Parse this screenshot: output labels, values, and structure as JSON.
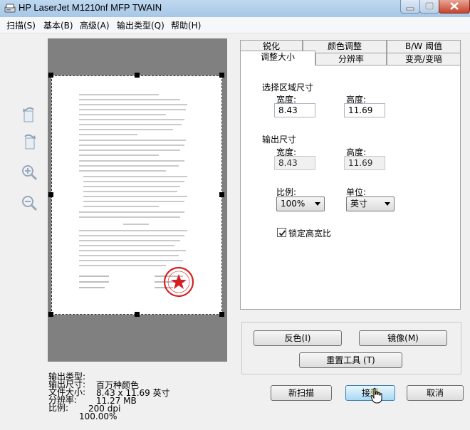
{
  "window": {
    "title": "HP LaserJet M1210nf MFP TWAIN",
    "icons": [
      "scanner-app-icon",
      "minimize-icon",
      "maximize-icon",
      "close-icon"
    ]
  },
  "menu": [
    {
      "label": "扫描(S)"
    },
    {
      "label": "基本(B)"
    },
    {
      "label": "高级(A)"
    },
    {
      "label": "输出类型(Q)"
    },
    {
      "label": "帮助(H)"
    }
  ],
  "tools": [
    "rotate-left-icon",
    "rotate-right-icon",
    "zoom-in-icon",
    "zoom-out-icon"
  ],
  "info": {
    "output_type_label": "输出类型:",
    "output_type_value": "百万种颜色",
    "output_size_label": "输出尺寸:",
    "output_size_value": "8.43 x 11.69 英寸",
    "file_size_label": "文件大小:",
    "file_size_value": "11.27 MB",
    "resolution_label": "分辨率:",
    "resolution_value": "200 dpi",
    "scale_label": "比例:",
    "scale_value": "100.00%"
  },
  "tabs": {
    "row1": [
      "锐化",
      "颜色调整",
      "B/W 阈值"
    ],
    "row2": [
      "调整大小",
      "分辨率",
      "变亮/变暗"
    ],
    "active": "调整大小"
  },
  "resize": {
    "select_area_heading": "选择区域尺寸",
    "width_label": "宽度:",
    "height_label": "高度:",
    "select_width": "8.43",
    "select_height": "11.69",
    "output_heading": "输出尺寸",
    "output_width_label": "宽度:",
    "output_height_label": "高度:",
    "output_width": "8.43",
    "output_height": "11.69",
    "ratio_label": "比例:",
    "ratio_value": "100%",
    "unit_label": "单位:",
    "unit_value": "英寸",
    "lock_label": "锁定高宽比",
    "lock_checked": true
  },
  "buttons": {
    "invert": "反色(I)",
    "mirror": "镜像(M)",
    "reset": "重置工具 (T)",
    "new_scan": "新扫描",
    "accept": "接受",
    "cancel": "取消"
  },
  "colors": {
    "preview_bg": "#808080",
    "title_bar": "#a7c7e6",
    "close_button": "#c7432b",
    "stamp_red": "#d62020"
  }
}
